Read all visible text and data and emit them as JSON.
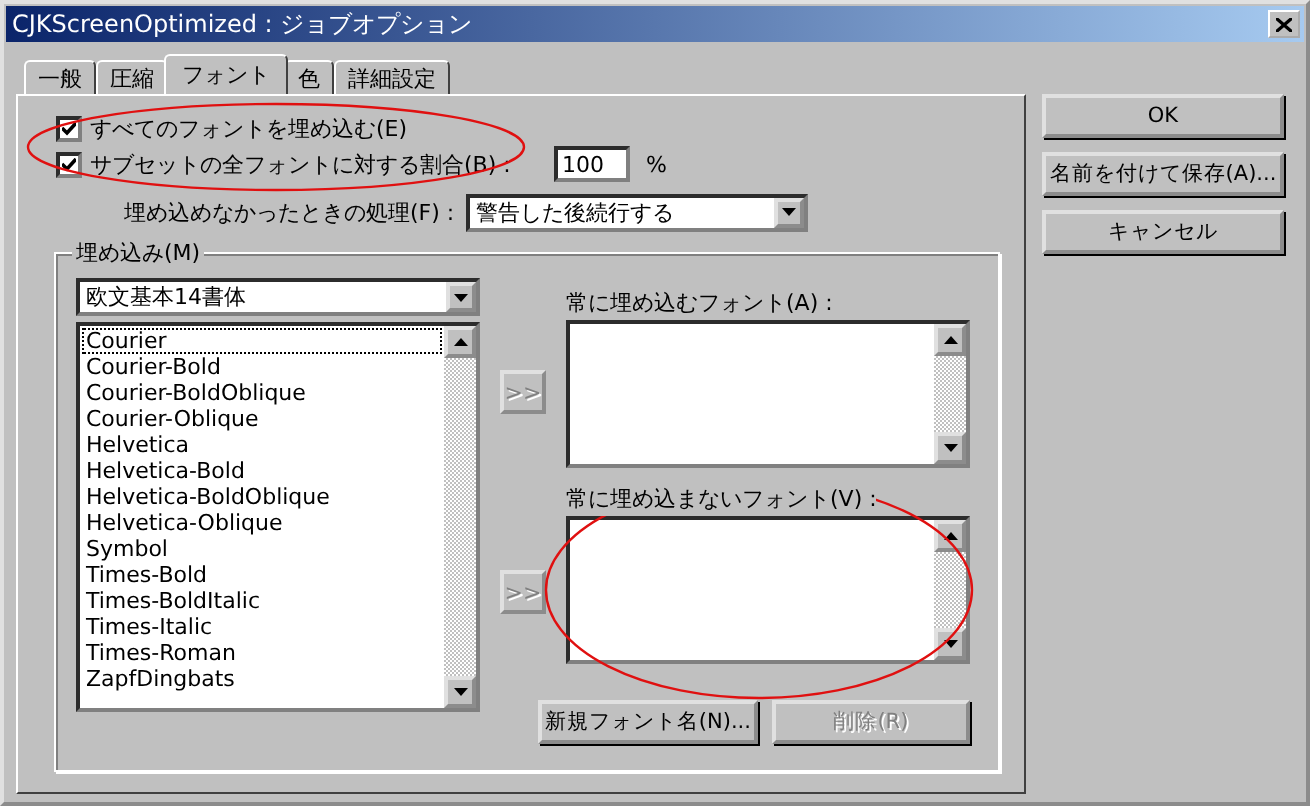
{
  "window": {
    "title": "CJKScreenOptimized : ジョブオプション"
  },
  "tabs": [
    {
      "label": "一般",
      "selected": false
    },
    {
      "label": "圧縮",
      "selected": false
    },
    {
      "label": "フォント",
      "selected": true
    },
    {
      "label": "色",
      "selected": false
    },
    {
      "label": "詳細設定",
      "selected": false
    }
  ],
  "embed_options": {
    "highlighted": true,
    "items": [
      {
        "label": "すべてのフォントを埋め込む(E)",
        "checked": true
      },
      {
        "label": "サブセットの全フォントに対する割合(B) :",
        "checked": true
      }
    ]
  },
  "subset_percent": {
    "value": "100",
    "unit": "%"
  },
  "on_failure": {
    "label": "埋め込めなかったときの処理(F) :",
    "value": "警告した後続行する"
  },
  "embedding": {
    "title": "埋め込み(M)",
    "font_set": "欧文基本14書体",
    "fonts": [
      {
        "name": "Courier",
        "focused": true
      },
      {
        "name": "Courier-Bold",
        "focused": false
      },
      {
        "name": "Courier-BoldOblique",
        "focused": false
      },
      {
        "name": "Courier-Oblique",
        "focused": false
      },
      {
        "name": "Helvetica",
        "focused": false
      },
      {
        "name": "Helvetica-Bold",
        "focused": false
      },
      {
        "name": "Helvetica-BoldOblique",
        "focused": false
      },
      {
        "name": "Helvetica-Oblique",
        "focused": false
      },
      {
        "name": "Symbol",
        "focused": false
      },
      {
        "name": "Times-Bold",
        "focused": false
      },
      {
        "name": "Times-BoldItalic",
        "focused": false
      },
      {
        "name": "Times-Italic",
        "focused": false
      },
      {
        "name": "Times-Roman",
        "focused": false
      },
      {
        "name": "ZapfDingbats",
        "focused": false
      }
    ],
    "always_embed": {
      "label": "常に埋め込むフォント(A) :",
      "add": ">>"
    },
    "never_embed": {
      "label": "常に埋め込まないフォント(V) :",
      "add": ">>",
      "highlighted": true
    },
    "buttons": [
      {
        "label": "新規フォント名(N)...",
        "disabled": false
      },
      {
        "label": "削除(R)",
        "disabled": true
      }
    ]
  },
  "side_buttons": [
    {
      "label": "OK"
    },
    {
      "label": "名前を付けて保存(A)..."
    },
    {
      "label": "キャンセル"
    }
  ]
}
